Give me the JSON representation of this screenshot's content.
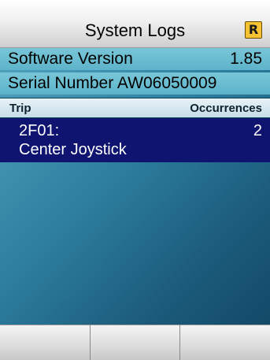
{
  "header": {
    "title": "System Logs",
    "badge": "R",
    "badge_color": "#f4c233"
  },
  "info": {
    "software_version_label": "Software Version",
    "software_version_value": "1.85",
    "serial_number_label": "Serial Number",
    "serial_number_value": "AW06050009"
  },
  "table": {
    "columns": [
      "Trip",
      "Occurrences"
    ],
    "rows": [
      {
        "code": "2F01:",
        "description": "Center Joystick",
        "occurrences": "2"
      }
    ]
  },
  "softkeys": [
    "",
    "",
    ""
  ],
  "colors": {
    "selection": "#0f1470",
    "background": "#2e7fa0",
    "info_row": "#5db3c9"
  }
}
